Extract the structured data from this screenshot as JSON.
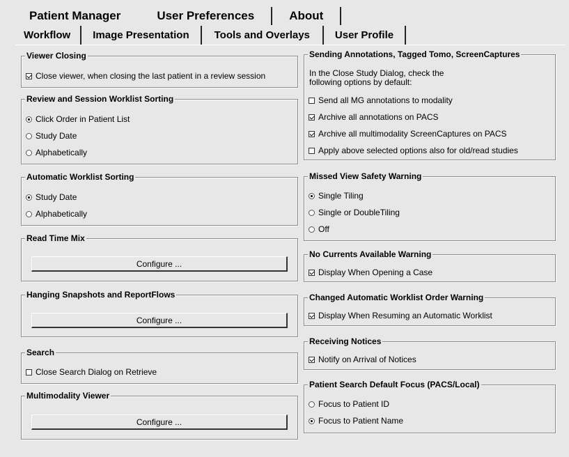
{
  "top_tabs": [
    "Patient Manager",
    "User Preferences",
    "About"
  ],
  "sub_tabs": [
    "Workflow",
    "Image Presentation",
    "Tools and Overlays",
    "User Profile"
  ],
  "left": {
    "viewer_closing": {
      "title": "Viewer Closing",
      "option": "Close viewer, when closing the last patient in a review session"
    },
    "review_sorting": {
      "title": "Review and Session Worklist Sorting",
      "options": [
        "Click Order in Patient List",
        "Study Date",
        "Alphabetically"
      ]
    },
    "auto_sorting": {
      "title": "Automatic Worklist Sorting",
      "options": [
        "Study Date",
        "Alphabetically"
      ]
    },
    "read_time_mix": {
      "title": "Read Time Mix",
      "button": "Configure ..."
    },
    "hanging": {
      "title": "Hanging Snapshots and ReportFlows",
      "button": "Configure ..."
    },
    "search": {
      "title": "Search",
      "option": "Close Search Dialog on Retrieve"
    },
    "multimodality": {
      "title": "Multimodality Viewer",
      "button": "Configure ..."
    }
  },
  "right": {
    "sending": {
      "title": "Sending Annotations, Tagged Tomo, ScreenCaptures",
      "intro1": "In the Close Study Dialog, check the",
      "intro2": "following options by default:",
      "options": [
        "Send all MG annotations to modality",
        "Archive all annotations on PACS",
        "Archive all multimodality ScreenCaptures on PACS",
        "Apply above selected options also for old/read studies"
      ]
    },
    "missed_view": {
      "title": "Missed View Safety Warning",
      "options": [
        "Single Tiling",
        "Single or DoubleTiling",
        "Off"
      ]
    },
    "no_currents": {
      "title": "No Currents Available Warning",
      "option": "Display When Opening a Case"
    },
    "changed_order": {
      "title": "Changed Automatic Worklist Order Warning",
      "option": "Display When Resuming an Automatic Worklist"
    },
    "receiving": {
      "title": "Receiving Notices",
      "option": "Notify on Arrival of Notices"
    },
    "patient_search": {
      "title": "Patient Search Default Focus (PACS/Local)",
      "options": [
        "Focus to Patient ID",
        "Focus to Patient Name"
      ]
    }
  }
}
